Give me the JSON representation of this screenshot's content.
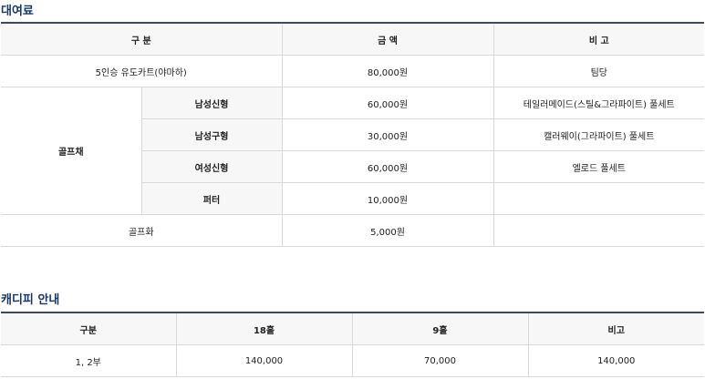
{
  "rental": {
    "title": "대여료",
    "headers": {
      "category": "구 분",
      "price": "금 액",
      "note": "비 고"
    },
    "cart": {
      "label": "5인승 유도카트(야마하)",
      "price": "80,000원",
      "note": "팀당"
    },
    "clubs": {
      "group_label": "골프채",
      "items": [
        {
          "name": "남성신형",
          "price": "60,000원",
          "note": "테일러메이드(스틸&그라파이트) 풀세트"
        },
        {
          "name": "남성구형",
          "price": "30,000원",
          "note": "캘러웨이(그라파이트) 풀세트"
        },
        {
          "name": "여성신형",
          "price": "60,000원",
          "note": "엘로드 풀세트"
        },
        {
          "name": "퍼터",
          "price": "10,000원",
          "note": ""
        }
      ]
    },
    "shoes": {
      "label": "골프화",
      "price": "5,000원",
      "note": ""
    }
  },
  "caddie": {
    "title": "캐디피 안내",
    "headers": {
      "category": "구분",
      "h18": "18홀",
      "h9": "9홀",
      "note": "비고"
    },
    "rows": [
      {
        "category": "1, 2부",
        "h18": "140,000",
        "h9": "70,000",
        "note": "140,000"
      }
    ]
  }
}
